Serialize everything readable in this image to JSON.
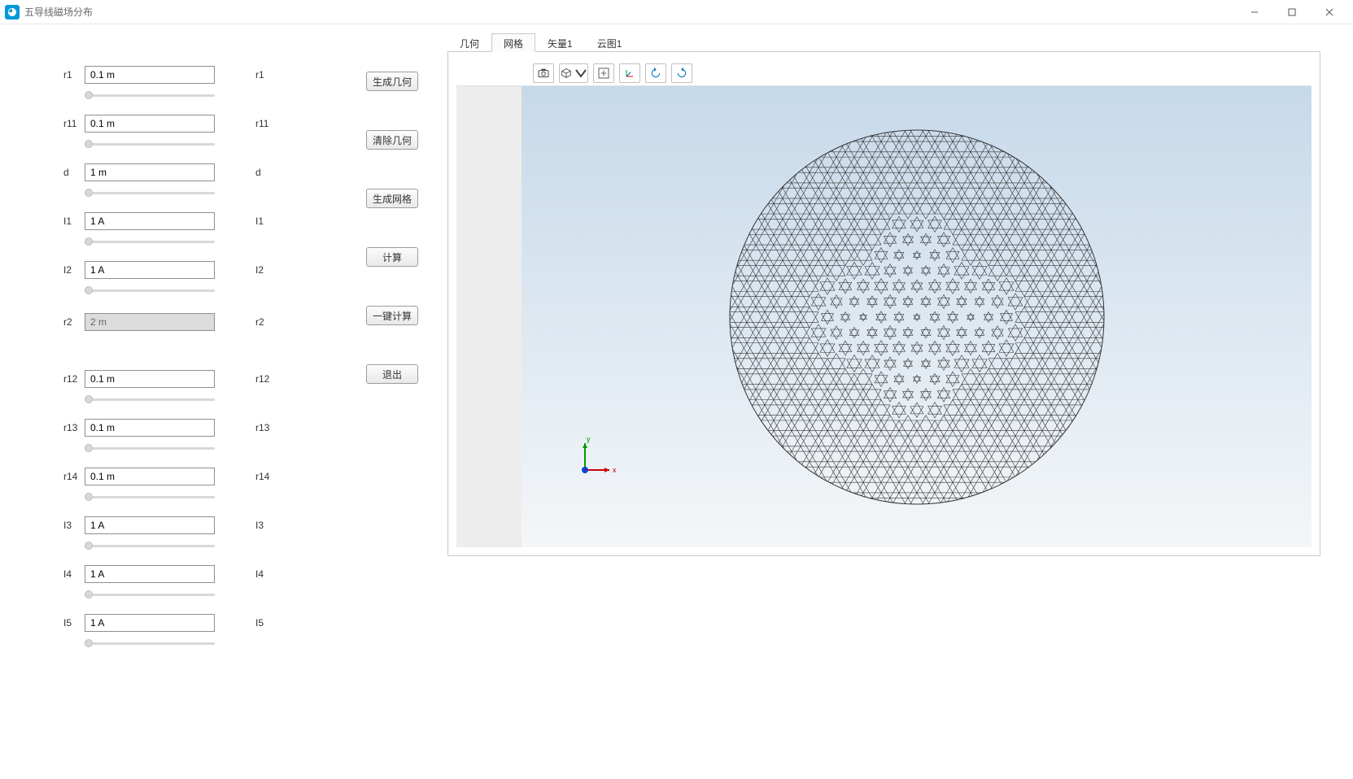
{
  "window": {
    "title": "五导线磁场分布"
  },
  "params": [
    {
      "id": "r1",
      "label_left": "r1",
      "value": "0.1 m",
      "label_right": "r1",
      "readonly": false,
      "has_slider": true
    },
    {
      "id": "r11",
      "label_left": "r11",
      "value": "0.1 m",
      "label_right": "r11",
      "readonly": false,
      "has_slider": true
    },
    {
      "id": "d",
      "label_left": "d",
      "value": "1 m",
      "label_right": "d",
      "readonly": false,
      "has_slider": true
    },
    {
      "id": "I1",
      "label_left": "I1",
      "value": "1 A",
      "label_right": "I1",
      "readonly": false,
      "has_slider": true
    },
    {
      "id": "I2",
      "label_left": "I2",
      "value": "1 A",
      "label_right": "I2",
      "readonly": false,
      "has_slider": true
    },
    {
      "id": "r2",
      "label_left": "r2",
      "value": "2 m",
      "label_right": "r2",
      "readonly": true,
      "has_slider": false
    },
    {
      "id": "r12",
      "label_left": "r12",
      "value": "0.1 m",
      "label_right": "r12",
      "readonly": false,
      "has_slider": true
    },
    {
      "id": "r13",
      "label_left": "r13",
      "value": "0.1 m",
      "label_right": "r13",
      "readonly": false,
      "has_slider": true
    },
    {
      "id": "r14",
      "label_left": "r14",
      "value": "0.1 m",
      "label_right": "r14",
      "readonly": false,
      "has_slider": true
    },
    {
      "id": "I3",
      "label_left": "I3",
      "value": "1 A",
      "label_right": "I3",
      "readonly": false,
      "has_slider": true
    },
    {
      "id": "I4",
      "label_left": "I4",
      "value": "1 A",
      "label_right": "I4",
      "readonly": false,
      "has_slider": true
    },
    {
      "id": "I5",
      "label_left": "I5",
      "value": "1 A",
      "label_right": "I5",
      "readonly": false,
      "has_slider": true
    }
  ],
  "actions": {
    "build_geom": "生成几何",
    "clear_geom": "清除几何",
    "build_mesh": "生成网格",
    "compute": "计算",
    "one_click": "一键计算",
    "exit": "退出"
  },
  "tabs": [
    {
      "id": "geom",
      "label": "几何",
      "active": false
    },
    {
      "id": "mesh",
      "label": "网格",
      "active": true
    },
    {
      "id": "vec1",
      "label": "矢量1",
      "active": false
    },
    {
      "id": "surf1",
      "label": "云图1",
      "active": false
    }
  ],
  "axis": {
    "x": "x",
    "y": "y"
  }
}
